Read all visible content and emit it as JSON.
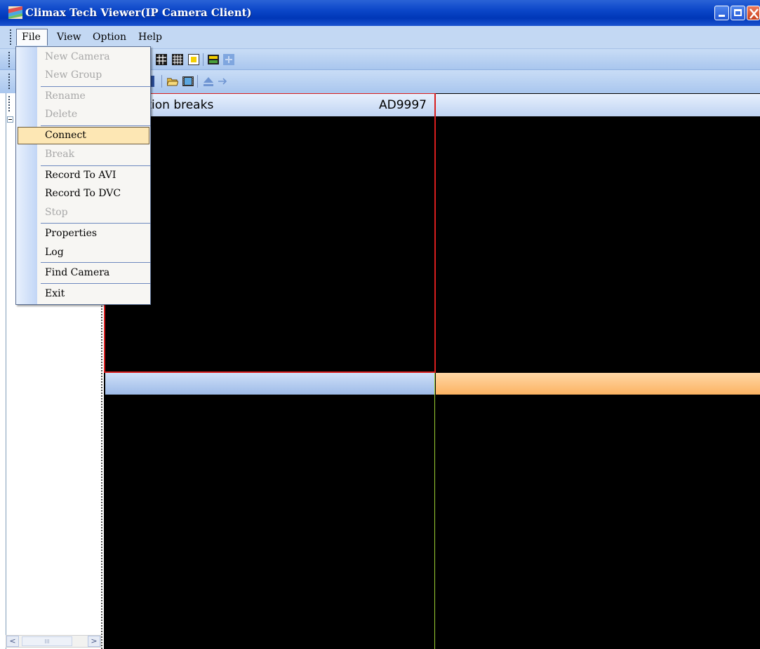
{
  "window": {
    "title": "Climax Tech Viewer(IP Camera Client)"
  },
  "menubar": {
    "file": "File",
    "view": "View",
    "option": "Option",
    "help": "Help"
  },
  "file_menu": {
    "new_camera": "New Camera",
    "new_group": "New Group",
    "rename": "Rename",
    "delete": "Delete",
    "connect": "Connect",
    "break": "Break",
    "record_avi": "Record To AVI",
    "record_dvc": "Record To DVC",
    "stop": "Stop",
    "properties": "Properties",
    "log": "Log",
    "find_camera": "Find Camera",
    "exit": "Exit"
  },
  "panes": {
    "pane1_title": "ction breaks",
    "pane1_model": "AD9997"
  },
  "scrollbar": {
    "left": "<",
    "right": ">",
    "thumb": "III"
  },
  "colors": {
    "titlebar": "#0b46c8",
    "menubar": "#c3d8f3",
    "active_pane": "#d81e1e",
    "highlight": "#fde7b4",
    "selected_pane": "#fcb362"
  }
}
